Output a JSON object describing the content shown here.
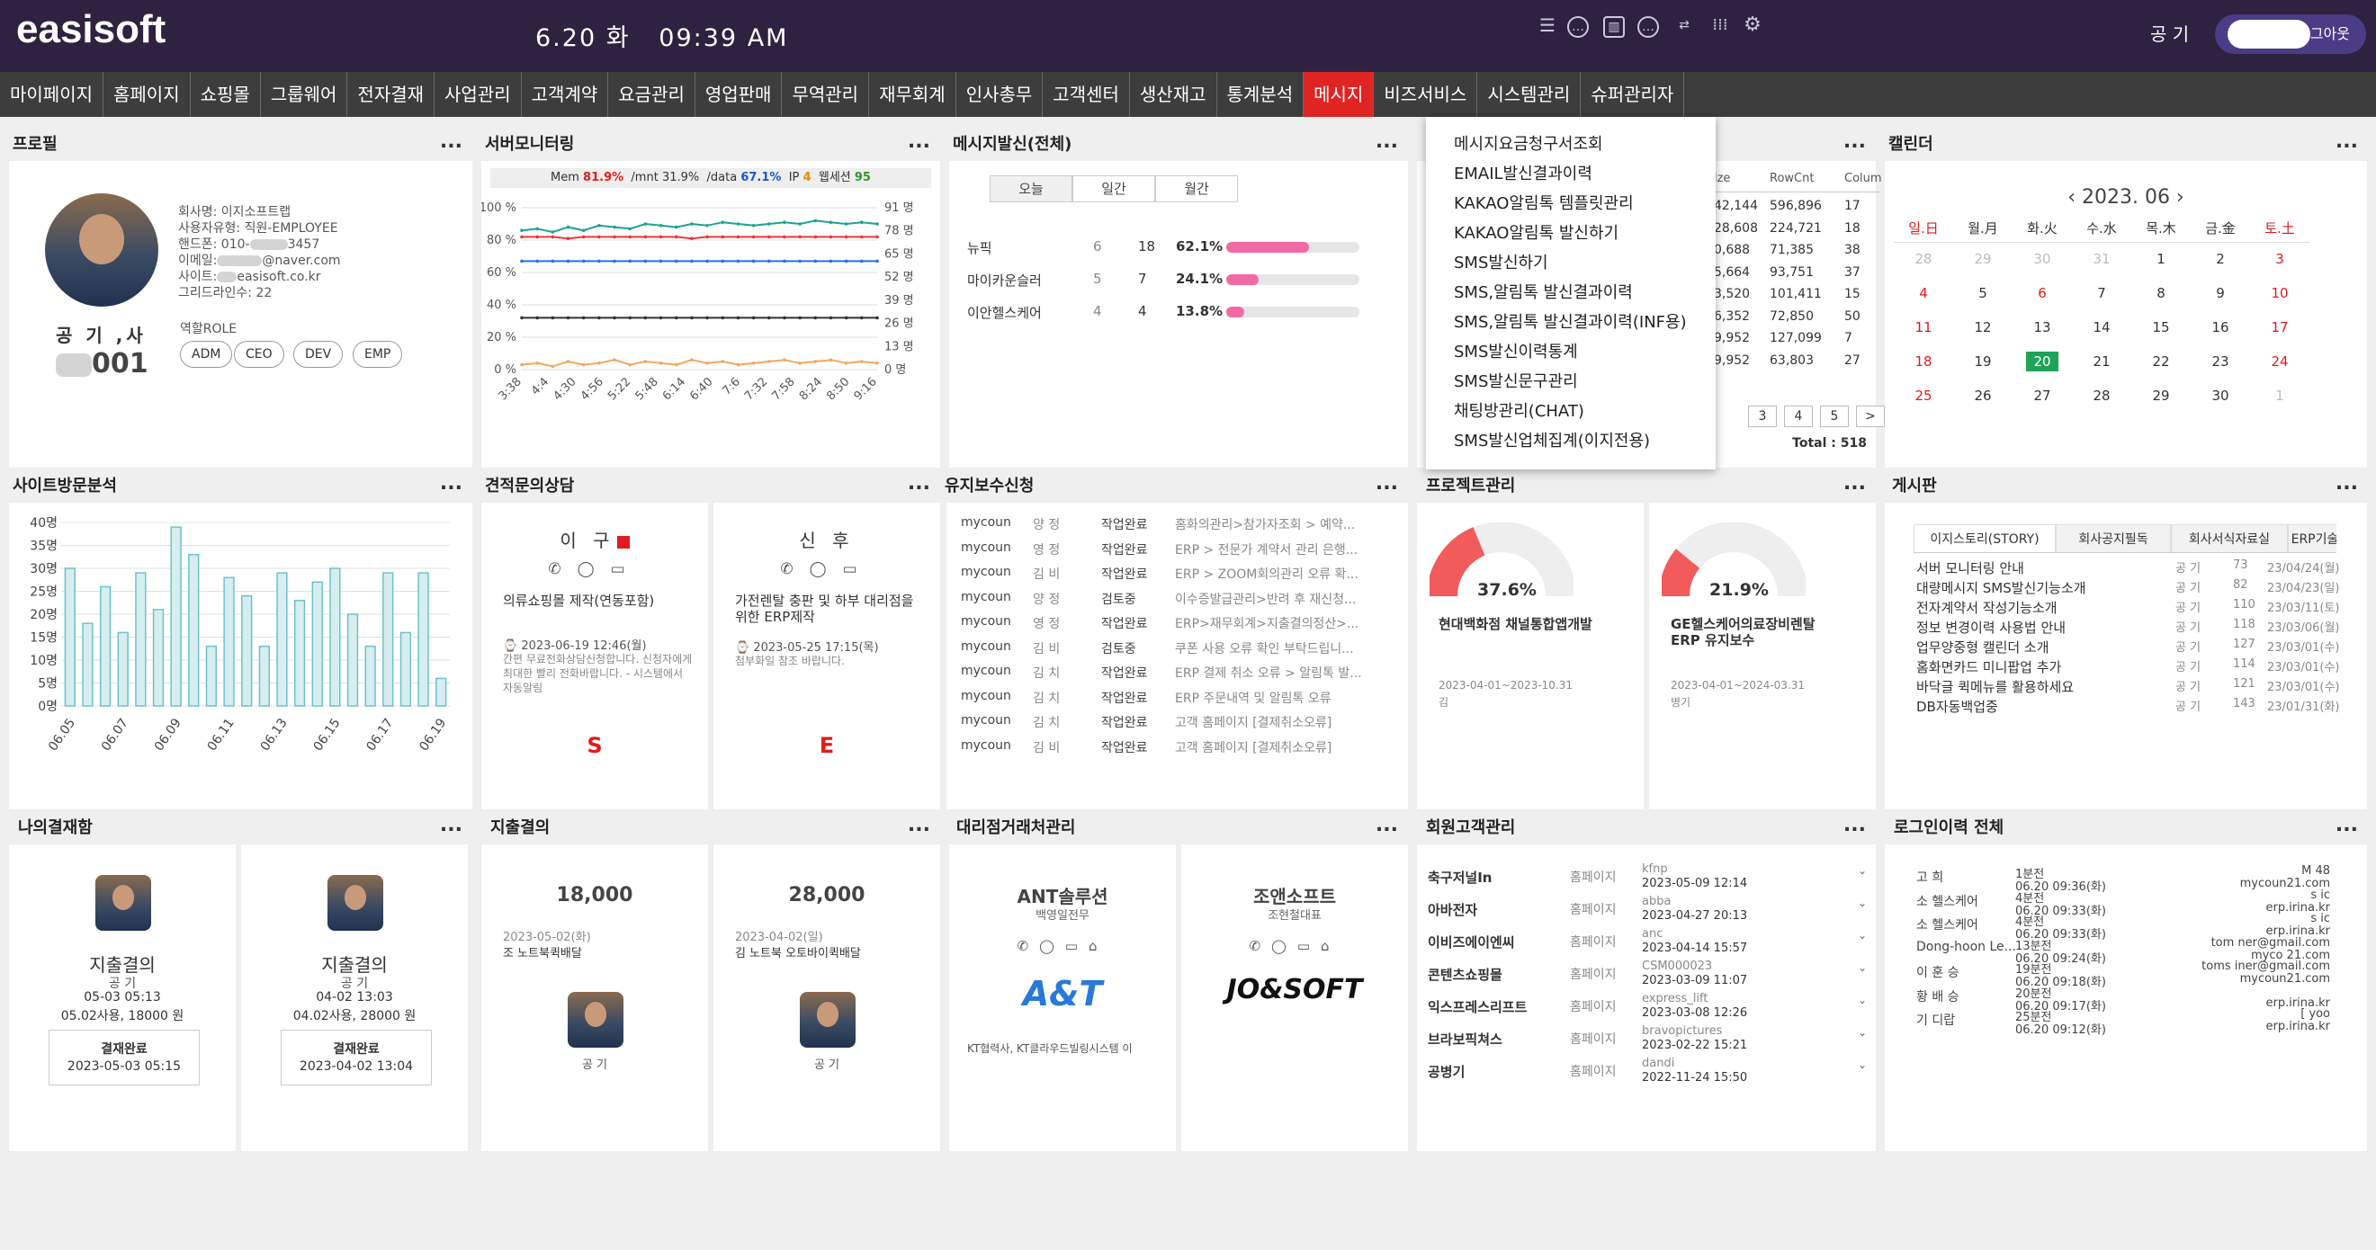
{
  "app": {
    "logo": "easisoft",
    "date": "6.20 화",
    "time": "09:39 AM",
    "user": "공 기",
    "logout": "로그아웃"
  },
  "nav": [
    "마이페이지",
    "홈페이지",
    "쇼핑몰",
    "그룹웨어",
    "전자결재",
    "사업관리",
    "고객계약",
    "요금관리",
    "영업판매",
    "무역관리",
    "재무회계",
    "인사총무",
    "고객센터",
    "생산재고",
    "통계분석",
    "메시지",
    "비즈서비스",
    "시스템관리",
    "슈퍼관리자"
  ],
  "nav_active": 15,
  "dropdown": [
    "메시지요금청구서조회",
    "EMAIL발신결과이력",
    "KAKAO알림톡 템플릿관리",
    "KAKAO알림톡 발신하기",
    "SMS발신하기",
    "SMS,알림톡 발신결과이력",
    "SMS,알림톡 발신결과이력(INF용)",
    "SMS발신이력통계",
    "SMS발신문구관리",
    "채팅방관리(CHAT)",
    "SMS발신업체집계(이지전용)"
  ],
  "more": "...",
  "titles": {
    "profile": "프로필",
    "server": "서버모니터링",
    "msg": "메시지발신(전체)",
    "calendar": "캘린더",
    "visit": "사이트방문분석",
    "estimate": "견적문의상담",
    "maint": "유지보수신청",
    "project": "프로젝트관리",
    "board": "게시판",
    "approval": "나의결재함",
    "expense": "지출결의",
    "agency": "대리점거래처관리",
    "member": "회원고객관리",
    "login": "로그인이력 전체"
  },
  "profile": {
    "company": "회사명: 이지소프트랩",
    "type": "사용자유형: 직원-EMPLOYEE",
    "phone_a": "핸드폰: 010-",
    "phone_b": "3457",
    "email_a": "이메일:",
    "email_b": "@naver.com",
    "site_a": "사이트:",
    "site_b": "easisoft.co.kr",
    "grid": "그리드라인수: 22",
    "name": "공 기 ,사",
    "code": "001",
    "role_label": "역할ROLE",
    "roles": [
      "ADM",
      "CEO",
      "DEV",
      "EMP"
    ]
  },
  "server": {
    "mem_label": "Mem",
    "mem": "81.9%",
    "mnt_label": "/mnt",
    "mnt": "31.9%",
    "data_label": "/data",
    "data": "67.1%",
    "ip_label": "IP",
    "ip": "4",
    "ws_label": "웹세션",
    "ws": "95"
  },
  "server_chart": {
    "type": "line",
    "yticks": [
      "100 %",
      "80 %",
      "60 %",
      "40 %",
      "20 %",
      "0 %"
    ],
    "y2ticks": [
      "91 명",
      "78 명",
      "65 명",
      "52 명",
      "39 명",
      "26 명",
      "13 명",
      "0 명"
    ],
    "xticks": [
      "3:38",
      "4:4",
      "4:30",
      "4:56",
      "5:22",
      "5:48",
      "6:14",
      "6:40",
      "7:6",
      "7:32",
      "7:58",
      "8:24",
      "8:50",
      "9:16"
    ],
    "ylim": [
      0,
      100
    ],
    "series": [
      {
        "color": "#1ea38f",
        "values": [
          86,
          87,
          85,
          88,
          86,
          89,
          88,
          87,
          90,
          89,
          88,
          90,
          89,
          91,
          90,
          89,
          90,
          91,
          90,
          92,
          91,
          90,
          91,
          90
        ]
      },
      {
        "color": "#2d6fe0",
        "values": [
          67,
          67,
          67,
          67,
          67,
          67,
          67,
          67,
          67,
          67,
          67,
          67,
          67,
          67,
          67,
          67,
          67,
          67,
          67,
          67,
          67,
          67,
          67,
          67
        ]
      },
      {
        "color": "#e83a3a",
        "values": [
          82,
          82,
          82,
          81,
          82,
          82,
          82,
          82,
          82,
          82,
          82,
          81,
          82,
          82,
          82,
          82,
          82,
          82,
          82,
          82,
          82,
          82,
          82,
          82
        ]
      },
      {
        "color": "#333333",
        "values": [
          32,
          32,
          32,
          32,
          32,
          32,
          32,
          32,
          32,
          32,
          32,
          32,
          32,
          32,
          32,
          32,
          32,
          32,
          32,
          32,
          32,
          32,
          32,
          32
        ]
      },
      {
        "color": "#f0a860",
        "values": [
          3,
          4,
          2,
          5,
          3,
          4,
          6,
          3,
          5,
          4,
          3,
          6,
          4,
          5,
          3,
          4,
          5,
          6,
          4,
          5,
          6,
          4,
          5,
          4
        ]
      }
    ]
  },
  "msg": {
    "tabs": [
      "오늘",
      "일간",
      "월간"
    ],
    "rows": [
      {
        "name": "뉴픽",
        "a": "6",
        "b": "18",
        "pct": "62.1%",
        "val": 62.1
      },
      {
        "name": "마이카운슬러",
        "a": "5",
        "b": "7",
        "pct": "24.1%",
        "val": 24.1
      },
      {
        "name": "이안헬스케어",
        "a": "4",
        "b": "4",
        "pct": "13.8%",
        "val": 13.8
      }
    ]
  },
  "db": {
    "headers": [
      "ize",
      "RowCnt",
      "Colum"
    ],
    "rows": [
      [
        "42,144",
        "596,896",
        "17"
      ],
      [
        "28,608",
        "224,721",
        "18"
      ],
      [
        "0,688",
        "71,385",
        "38"
      ],
      [
        "5,664",
        "93,751",
        "37"
      ],
      [
        "3,520",
        "101,411",
        "15"
      ],
      [
        "6,352",
        "72,850",
        "50"
      ],
      [
        "9,952",
        "127,099",
        "7"
      ],
      [
        "9,952",
        "63,803",
        "27"
      ]
    ],
    "pages": [
      "3",
      "4",
      "5",
      ">"
    ],
    "total": "Total : 518"
  },
  "calendar": {
    "title": "2023. 06",
    "days": [
      "일.日",
      "월.月",
      "화.火",
      "수.水",
      "목.木",
      "금.金",
      "토.土"
    ],
    "weeks": [
      [
        "28",
        "29",
        "30",
        "31",
        "1",
        "2",
        "3"
      ],
      [
        "4",
        "5",
        "6",
        "7",
        "8",
        "9",
        "10"
      ],
      [
        "11",
        "12",
        "13",
        "14",
        "15",
        "16",
        "17"
      ],
      [
        "18",
        "19",
        "20",
        "21",
        "22",
        "23",
        "24"
      ],
      [
        "25",
        "26",
        "27",
        "28",
        "29",
        "30",
        "1"
      ]
    ],
    "today": "20"
  },
  "visit_chart": {
    "type": "bar",
    "yticks": [
      "40명",
      "35명",
      "30명",
      "25명",
      "20명",
      "15명",
      "10명",
      "5명",
      "0명"
    ],
    "ylim": [
      0,
      40
    ],
    "xticks": [
      "06.05",
      "06.07",
      "06.09",
      "06.11",
      "06.13",
      "06.15",
      "06.17",
      "06.19"
    ],
    "values": [
      30,
      18,
      26,
      16,
      29,
      21,
      39,
      33,
      13,
      28,
      24,
      13,
      29,
      23,
      27,
      30,
      20,
      13,
      29,
      16,
      29,
      6
    ]
  },
  "estimate": [
    {
      "name": "이 구",
      "title": "의류쇼핑몰 제작(연동포함)",
      "date": "2023-06-19 12:46(월)",
      "desc": "간편 무료전화상담신청합니다. 신청자에게 최대한 빨리 전화바랍니다. - 시스템에서 자동알림",
      "letter": "S"
    },
    {
      "name": "신 후",
      "title": "가전렌탈 충판 및 하부 대리점을 위한 ERP제작",
      "date": "2023-05-25 17:15(목)",
      "desc": "첨부화일 참조 바랍니다.",
      "letter": "E"
    }
  ],
  "maint": [
    [
      "mycoun",
      "양 정",
      "작업완료",
      "홈화의관리>참가자조회 > 예약..."
    ],
    [
      "mycoun",
      "영 정",
      "작업완료",
      "ERP > 전문가 계약서 관리 은행..."
    ],
    [
      "mycoun",
      "김 비",
      "작업완료",
      "ERP > ZOOM회의관리 오류 확..."
    ],
    [
      "mycoun",
      "양 정",
      "검토중",
      "이수증발급관리>반려 후 재신청..."
    ],
    [
      "mycoun",
      "영 정",
      "작업완료",
      "ERP>재무회계>지출결의정산>..."
    ],
    [
      "mycoun",
      "김 비",
      "검토중",
      "쿠폰 사용 오류 확인 부탁드립니..."
    ],
    [
      "mycoun",
      "김 치",
      "작업완료",
      "ERP 결제 취소 오류 > 알림톡 발..."
    ],
    [
      "mycoun",
      "김 치",
      "작업완료",
      "ERP 주문내역 및 알림톡 오류"
    ],
    [
      "mycoun",
      "김 치",
      "작업완료",
      "고객 홈페이지 [결제취소오류]"
    ],
    [
      "mycoun",
      "김 비",
      "작업완료",
      "고객 홈페이지 [결제취소오류]"
    ]
  ],
  "project": [
    {
      "pct": "37.6%",
      "val": 37.6,
      "name": "현대백화점 채널통합앱개발",
      "date": "2023-04-01~2023-10.31",
      "owner": "김"
    },
    {
      "pct": "21.9%",
      "val": 21.9,
      "name": "GE헬스케어의료장비렌탈 ERP 유지보수",
      "date": "2023-04-01~2024-03.31",
      "owner": "병기"
    }
  ],
  "board": {
    "tabs": [
      "이지스토리(STORY)",
      "회사공지필독",
      "회사서식자료실",
      "ERP기술"
    ],
    "rows": [
      [
        "서버 모니터링 안내",
        "공 기",
        "73",
        "23/04/24(월)"
      ],
      [
        "대량메시지 SMS발신기능소개",
        "공 기",
        "82",
        "23/04/23(일)"
      ],
      [
        "전자계약서 작성기능소개",
        "공 기",
        "110",
        "23/03/11(토)"
      ],
      [
        "정보 변경이력 사용법 안내",
        "공 기",
        "118",
        "23/03/06(월)"
      ],
      [
        "업무양중형 캘린더 소개",
        "공 기",
        "127",
        "23/03/01(수)"
      ],
      [
        "홈화면카드 미니팝업 추가",
        "공 기",
        "114",
        "23/03/01(수)"
      ],
      [
        "바닥글 퀵메뉴를 활용하세요",
        "공 기",
        "121",
        "23/03/01(수)"
      ],
      [
        "DB자동백업중",
        "공 기",
        "143",
        "23/01/31(화)"
      ]
    ]
  },
  "approval": [
    {
      "title": "지출결의",
      "who": "공 기",
      "date": "05-03 05:13",
      "desc": "05.02사용, 18000 원",
      "status": "결재완료",
      "time": "2023-05-03 05:15"
    },
    {
      "title": "지출결의",
      "who": "공 기",
      "date": "04-02 13:03",
      "desc": "04.02사용, 28000 원",
      "status": "결재완료",
      "time": "2023-04-02 13:04"
    }
  ],
  "expense": [
    {
      "amount": "18,000",
      "date": "2023-05-02(화)",
      "desc": "조 노트북퀵배달",
      "who": "공 기"
    },
    {
      "amount": "28,000",
      "date": "2023-04-02(일)",
      "desc": "김 노트북 오토바이퀵배달",
      "who": "공 기"
    }
  ],
  "agency": [
    {
      "name": "ANT솔루션",
      "rep": "백영일전무",
      "logo": "A&T",
      "desc": "KT협력사, KT클라우드빌링시스템 이"
    },
    {
      "name": "조앤소프트",
      "rep": "조현철대표",
      "logo": "JO&SOFT",
      "desc": ""
    }
  ],
  "member": [
    [
      "축구저널In",
      "홈페이지",
      "kfnp",
      "2023-05-09 12:14"
    ],
    [
      "아바전자",
      "홈페이지",
      "abba",
      "2023-04-27 20:13"
    ],
    [
      "이비즈에이엔씨",
      "홈페이지",
      "anc",
      "2023-04-14 15:57"
    ],
    [
      "콘텐츠쇼핑몰",
      "홈페이지",
      "CSM000023",
      "2023-03-09 11:07"
    ],
    [
      "익스프레스리프트",
      "홈페이지",
      "express_lift",
      "2023-03-08 12:26"
    ],
    [
      "브라보픽쳐스",
      "홈페이지",
      "bravopictures",
      "2023-02-22 15:21"
    ],
    [
      "공병기",
      "홈페이지",
      "dandi",
      "2022-11-24 15:50"
    ]
  ],
  "login": [
    [
      "고 희",
      "1분전",
      "06.20 09:36(화)",
      "M 48",
      "mycoun21.com"
    ],
    [
      "소 헬스케어",
      "4분전",
      "06.20 09:33(화)",
      "s ic",
      "erp.irina.kr"
    ],
    [
      "소 헬스케어",
      "4분전",
      "06.20 09:33(화)",
      "s ic",
      "erp.irina.kr"
    ],
    [
      "Dong-hoon Le...",
      "13분전",
      "06.20 09:24(화)",
      "tom ner@gmail.com",
      "myco 21.com"
    ],
    [
      "이 훈 승",
      "19분전",
      "06.20 09:18(화)",
      "toms iner@gmail.com",
      "mycoun21.com"
    ],
    [
      "황 배 승",
      "20분전",
      "06.20 09:17(화)",
      "",
      "erp.irina.kr"
    ],
    [
      "기 디랍",
      "25분전",
      "06.20 09:12(화)",
      "[ yoo",
      "erp.irina.kr"
    ]
  ]
}
